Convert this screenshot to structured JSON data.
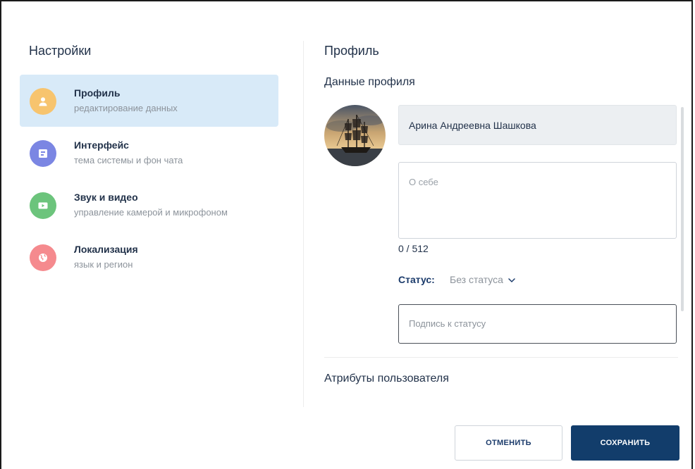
{
  "settings": {
    "title": "Настройки",
    "items": [
      {
        "title": "Профиль",
        "subtitle": "редактирование данных",
        "icon": "user-icon",
        "color": "#f7c46e",
        "active": true
      },
      {
        "title": "Интерфейс",
        "subtitle": "тема системы и фон чата",
        "icon": "palette-icon",
        "color": "#7b86e3",
        "active": false
      },
      {
        "title": "Звук и видео",
        "subtitle": "управление камерой и микрофоном",
        "icon": "video-icon",
        "color": "#6cc47c",
        "active": false
      },
      {
        "title": "Локализация",
        "subtitle": "язык и регион",
        "icon": "globe-icon",
        "color": "#f58a8e",
        "active": false
      }
    ]
  },
  "profile": {
    "title": "Профиль",
    "section_title": "Данные профиля",
    "name_value": "Арина Андреевна Шашкова",
    "about_placeholder": "О себе",
    "about_counter": "0 / 512",
    "status_label": "Статус:",
    "status_value": "Без статуса",
    "status_caption_placeholder": "Подпись к статусу",
    "attributes_title": "Атрибуты пользователя"
  },
  "actions": {
    "cancel_label": "ОТМЕНИТЬ",
    "save_label": "СОХРАНИТЬ"
  },
  "colors": {
    "accent": "#123d6b",
    "active_item_bg": "#d8eaf8"
  }
}
